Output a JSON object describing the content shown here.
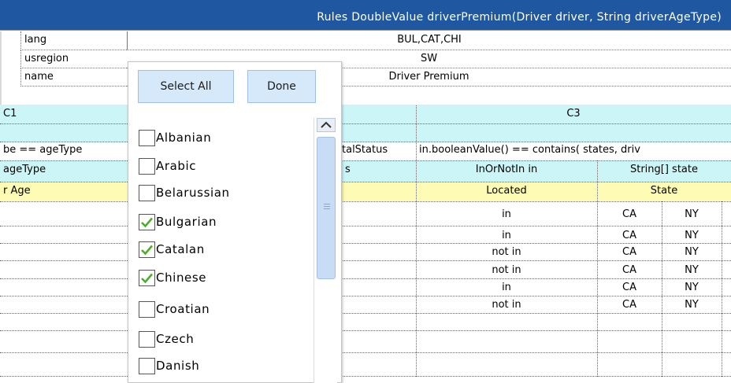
{
  "header": {
    "title": "Rules DoubleValue driverPremium(Driver driver, String driverAgeType)"
  },
  "properties": [
    {
      "name": "lang",
      "value": "BUL,CAT,CHI"
    },
    {
      "name": "usregion",
      "value": "SW"
    },
    {
      "name": "name",
      "value": "Driver Premium"
    }
  ],
  "conditions": {
    "c1": {
      "id": "C1",
      "expr": "be == ageType",
      "param": "ageType",
      "title": "r Age"
    },
    "c2": {
      "expr": "talStatus",
      "param": "s"
    },
    "c3": {
      "id": "C3",
      "expr": "in.booleanValue() == contains( states, driv",
      "param1": "InOrNotIn in",
      "param2": "String[] state",
      "title1": "Located",
      "title2": "State"
    }
  },
  "rows": [
    {
      "in": "in",
      "s1": "CA",
      "s2": "NY"
    },
    {
      "in": "in",
      "s1": "CA",
      "s2": "NY"
    },
    {
      "in": "not in",
      "s1": "CA",
      "s2": "NY"
    },
    {
      "in": "not in",
      "s1": "CA",
      "s2": "NY"
    },
    {
      "in": "in",
      "s1": "CA",
      "s2": "NY"
    },
    {
      "in": "not in",
      "s1": "CA",
      "s2": "NY"
    }
  ],
  "popup": {
    "select_all": "Select All",
    "done": "Done",
    "items": [
      {
        "label": "Albanian",
        "checked": false
      },
      {
        "label": "Arabic",
        "checked": false
      },
      {
        "label": "Belarussian",
        "checked": false
      },
      {
        "label": "Bulgarian",
        "checked": true
      },
      {
        "label": "Catalan",
        "checked": true
      },
      {
        "label": "Chinese",
        "checked": true
      },
      {
        "label": "Croatian",
        "checked": false
      },
      {
        "label": "Czech",
        "checked": false
      },
      {
        "label": "Danish",
        "checked": false
      }
    ]
  },
  "colors": {
    "header": "#1f58a0",
    "cyan": "#ccf5f8",
    "yellow": "#fdfbb4",
    "check": "#4caf28",
    "popup_button": "#d6e9fb"
  }
}
